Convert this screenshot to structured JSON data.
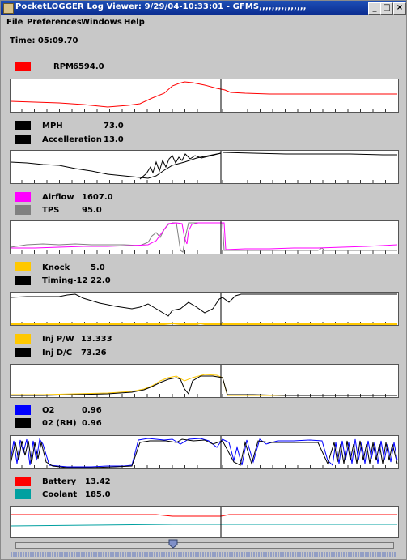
{
  "window": {
    "title": "PocketLOGGER Log Viewer: 9/29/04-10:33:01 - GFMS,,,,,,,,,,,,,,,",
    "minimize_glyph": "_",
    "maximize_glyph": "□",
    "close_glyph": "×"
  },
  "menu": {
    "file": "File",
    "preferences": "Preferences",
    "windows": "Windows",
    "help": "Help"
  },
  "time": "Time: 05:09.70",
  "channels": {
    "rpm": {
      "label": "RPM",
      "value": "6594.0",
      "color": "#ff0000"
    },
    "mph": {
      "label": "MPH",
      "value": "73.0",
      "color": "#000000"
    },
    "accel": {
      "label": "Accelleration",
      "value": "13.0",
      "color": "#000000"
    },
    "airflow": {
      "label": "Airflow",
      "value": "1607.0",
      "color": "#ff00ff"
    },
    "tps": {
      "label": "TPS",
      "value": "95.0",
      "color": "#808080"
    },
    "knock": {
      "label": "Knock",
      "value": "5.0",
      "color": "#ffc800"
    },
    "timing": {
      "label": "Timing-12",
      "value": "22.0",
      "color": "#000000"
    },
    "injpw": {
      "label": "Inj P/W",
      "value": "13.333",
      "color": "#ffc800"
    },
    "injdc": {
      "label": "Inj D/C",
      "value": "73.26",
      "color": "#000000"
    },
    "o2": {
      "label": "O2",
      "value": "0.96",
      "color": "#0000ff"
    },
    "o2rh": {
      "label": "02 (RH)",
      "value": "0.96",
      "color": "#000000"
    },
    "battery": {
      "label": "Battery",
      "value": "13.42",
      "color": "#ff0000"
    },
    "coolant": {
      "label": "Coolant",
      "value": "185.0",
      "color": "#00a0a0"
    }
  },
  "accent": {
    "cursor": "#000000",
    "titlebar": "#0a2b8f"
  }
}
